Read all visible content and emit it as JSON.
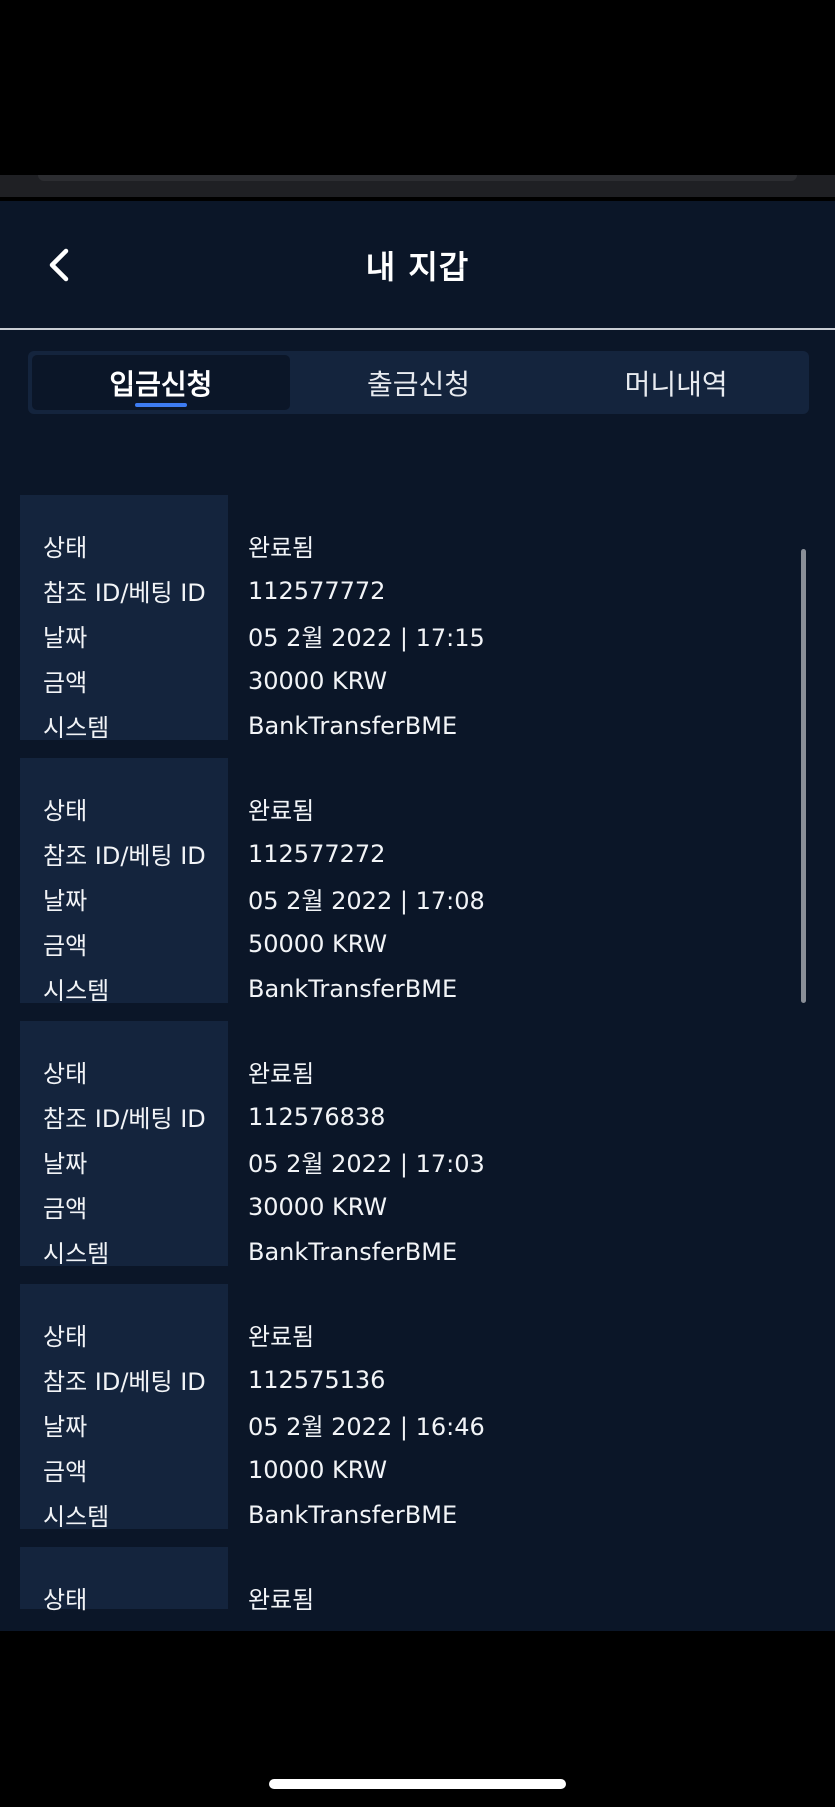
{
  "header": {
    "title": "내 지갑",
    "back_icon": "chevron-left-icon"
  },
  "tabs": [
    {
      "label": "입금신청",
      "active": true
    },
    {
      "label": "출금신청",
      "active": false
    },
    {
      "label": "머니내역",
      "active": false
    }
  ],
  "labels": {
    "status": "상태",
    "ref_id": "참조 ID/베팅 ID",
    "date": "날짜",
    "amount": "금액",
    "system": "시스템"
  },
  "transactions": [
    {
      "status": "완료됨",
      "ref_id": "112577772",
      "date": "05 2월 2022 | 17:15",
      "amount": "30000 KRW",
      "system": "BankTransferBME"
    },
    {
      "status": "완료됨",
      "ref_id": "112577272",
      "date": "05 2월 2022 | 17:08",
      "amount": "50000 KRW",
      "system": "BankTransferBME"
    },
    {
      "status": "완료됨",
      "ref_id": "112576838",
      "date": "05 2월 2022 | 17:03",
      "amount": "30000 KRW",
      "system": "BankTransferBME"
    },
    {
      "status": "완료됨",
      "ref_id": "112575136",
      "date": "05 2월 2022 | 16:46",
      "amount": "10000 KRW",
      "system": "BankTransferBME"
    },
    {
      "status": "완료됨"
    }
  ],
  "colors": {
    "background": "#0b1628",
    "panel": "#14243d",
    "accent": "#3d7cf2",
    "text": "#ffffff"
  }
}
